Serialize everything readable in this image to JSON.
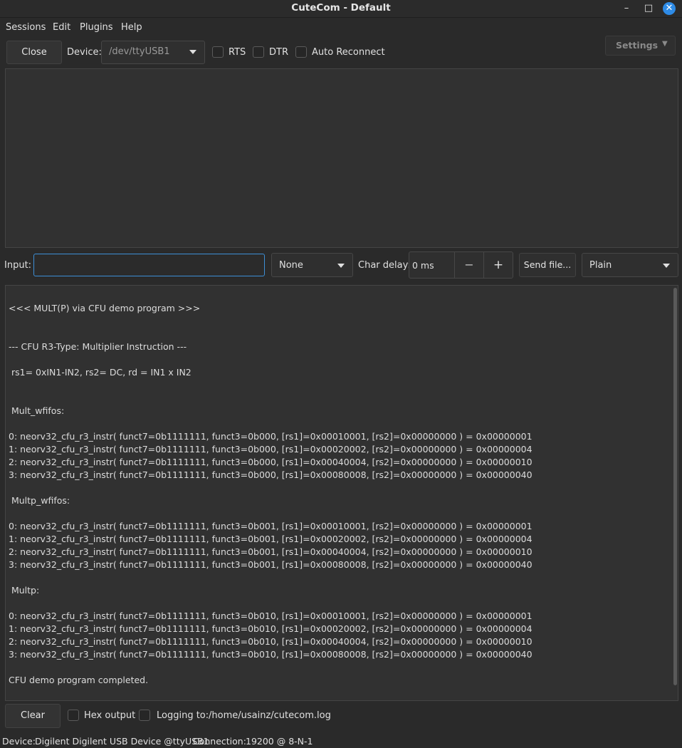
{
  "window": {
    "title": "CuteCom - Default"
  },
  "menu": [
    "Sessions",
    "Edit",
    "Plugins",
    "Help"
  ],
  "toolbar": {
    "close_label": "Close",
    "device_label": "Device:",
    "device_value": "/dev/ttyUSB1",
    "rts_label": "RTS",
    "dtr_label": "DTR",
    "auto_reconnect_label": "Auto Reconnect",
    "settings_label": "Settings"
  },
  "input_row": {
    "input_label": "Input:",
    "input_value": "",
    "line_end_value": "None",
    "char_delay_label": "Char delay:",
    "char_delay_value": "0 ms",
    "minus_label": "−",
    "plus_label": "+",
    "send_file_label": "Send file...",
    "format_value": "Plain"
  },
  "output": {
    "lines": [
      "<<< MULT(P) via CFU demo program >>>",
      "--- CFU R3-Type: Multiplier Instruction ---",
      " rs1= 0xIN1-IN2, rs2= DC, rd = IN1 x IN2",
      " Mult_wfifos:",
      "0: neorv32_cfu_r3_instr( funct7=0b1111111, funct3=0b000, [rs1]=0x00010001, [rs2]=0x00000000 ) = 0x00000001",
      "1: neorv32_cfu_r3_instr( funct7=0b1111111, funct3=0b000, [rs1]=0x00020002, [rs2]=0x00000000 ) = 0x00000004",
      "2: neorv32_cfu_r3_instr( funct7=0b1111111, funct3=0b000, [rs1]=0x00040004, [rs2]=0x00000000 ) = 0x00000010",
      "3: neorv32_cfu_r3_instr( funct7=0b1111111, funct3=0b000, [rs1]=0x00080008, [rs2]=0x00000000 ) = 0x00000040",
      " Multp_wfifos:",
      "0: neorv32_cfu_r3_instr( funct7=0b1111111, funct3=0b001, [rs1]=0x00010001, [rs2]=0x00000000 ) = 0x00000001",
      "1: neorv32_cfu_r3_instr( funct7=0b1111111, funct3=0b001, [rs1]=0x00020002, [rs2]=0x00000000 ) = 0x00000004",
      "2: neorv32_cfu_r3_instr( funct7=0b1111111, funct3=0b001, [rs1]=0x00040004, [rs2]=0x00000000 ) = 0x00000010",
      "3: neorv32_cfu_r3_instr( funct7=0b1111111, funct3=0b001, [rs1]=0x00080008, [rs2]=0x00000000 ) = 0x00000040",
      " Multp:",
      "0: neorv32_cfu_r3_instr( funct7=0b1111111, funct3=0b010, [rs1]=0x00010001, [rs2]=0x00000000 ) = 0x00000001",
      "1: neorv32_cfu_r3_instr( funct7=0b1111111, funct3=0b010, [rs1]=0x00020002, [rs2]=0x00000000 ) = 0x00000004",
      "2: neorv32_cfu_r3_instr( funct7=0b1111111, funct3=0b010, [rs1]=0x00040004, [rs2]=0x00000000 ) = 0x00000010",
      "3: neorv32_cfu_r3_instr( funct7=0b1111111, funct3=0b010, [rs1]=0x00080008, [rs2]=0x00000000 ) = 0x00000040",
      "CFU demo program completed."
    ]
  },
  "bottom": {
    "clear_label": "Clear",
    "hex_output_label": "Hex output",
    "logging_label": "Logging to:",
    "log_path": "/home/usainz/cutecom.log"
  },
  "status": {
    "device_label": "Device:",
    "device_value": "Digilent Digilent USB Device @ttyUSB1",
    "connection_label": "Connection:",
    "connection_value": "19200 @ 8-N-1"
  }
}
